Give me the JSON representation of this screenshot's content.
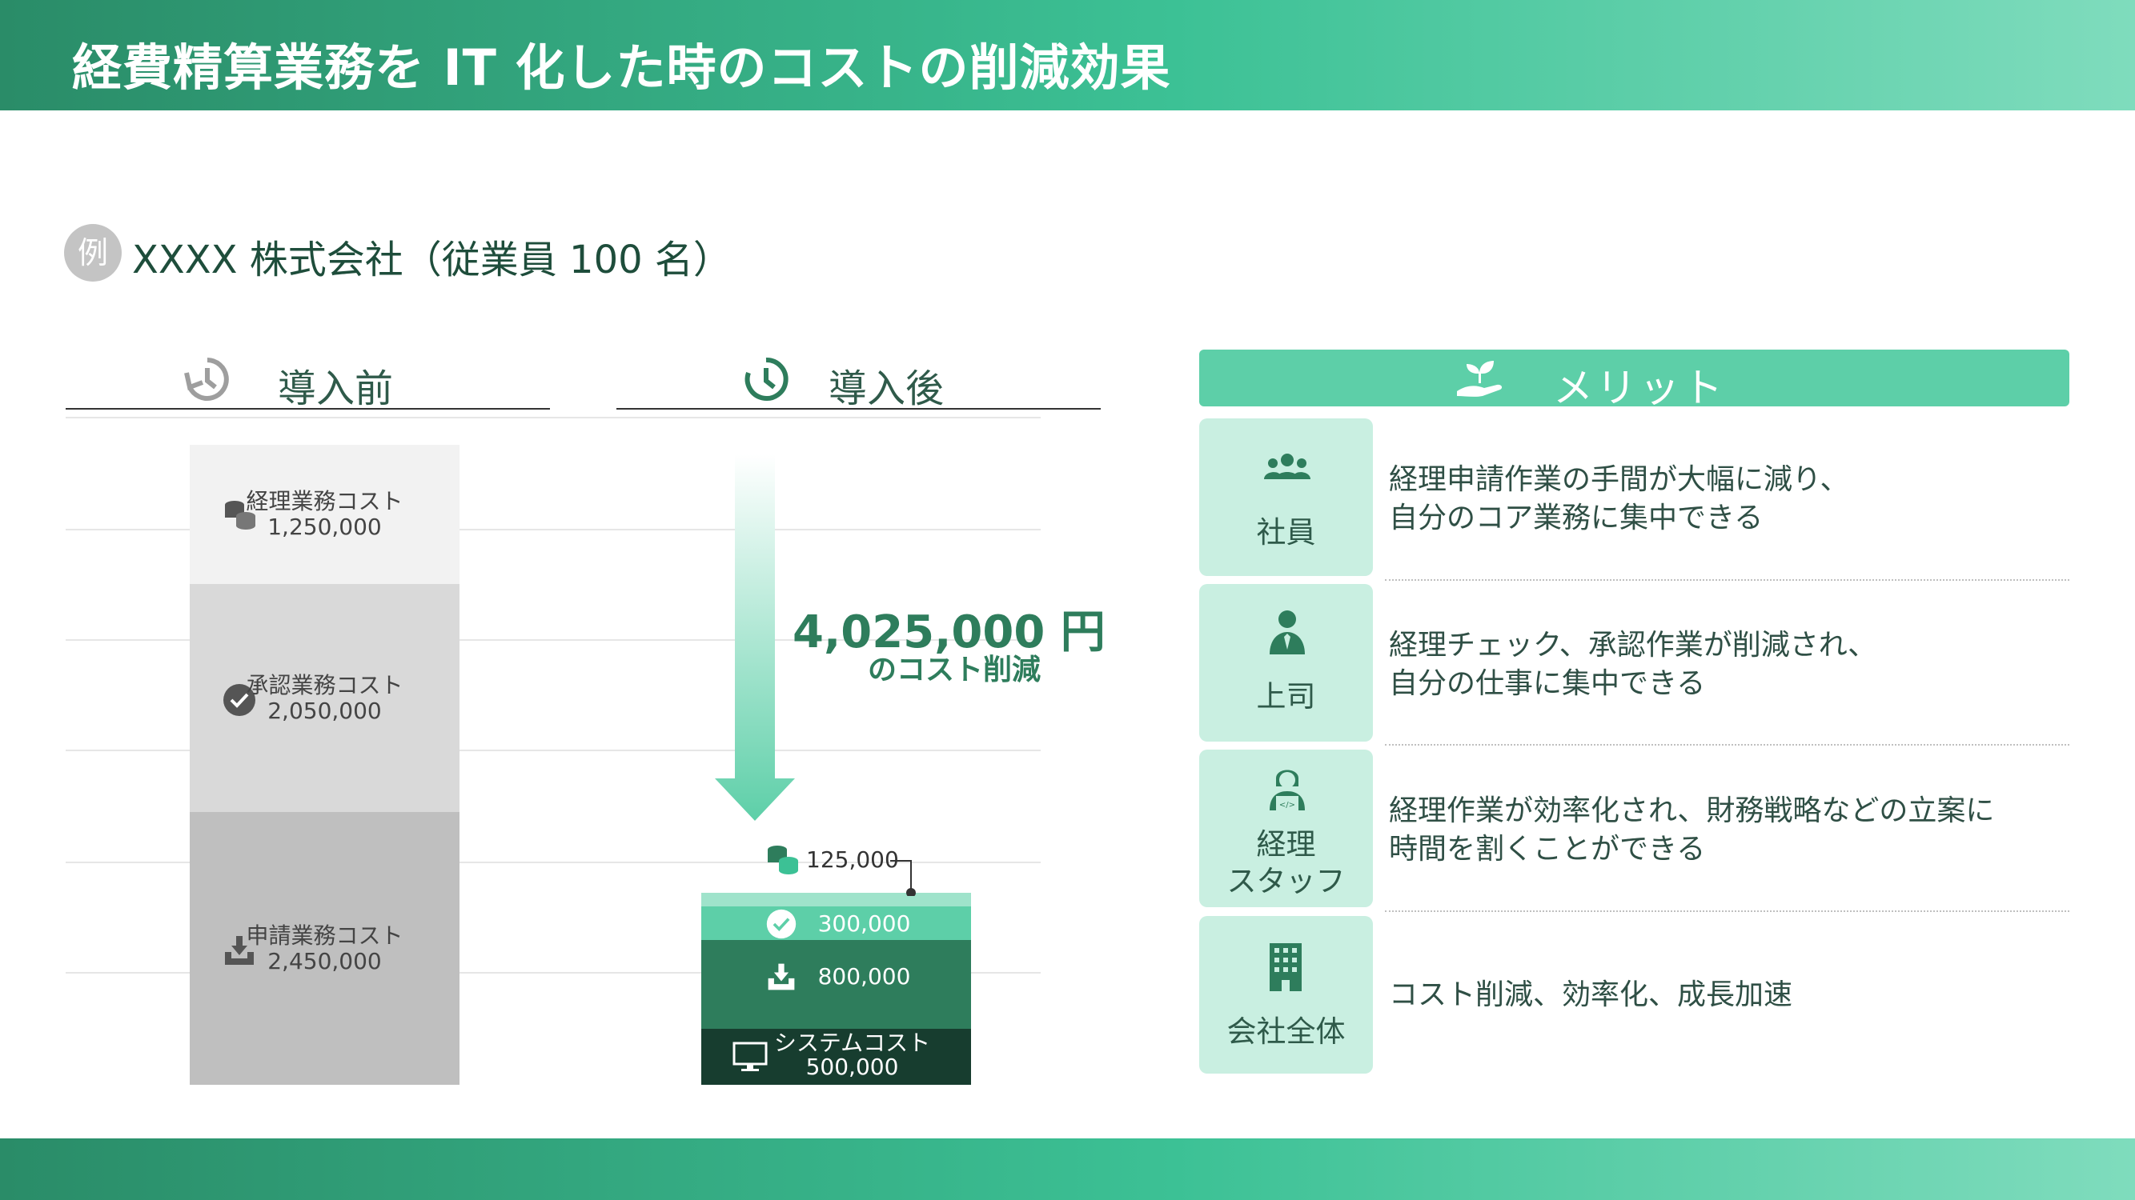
{
  "title": "経費精算業務を IT 化した時のコストの削減効果",
  "example_badge": "例",
  "company": "XXXX 株式会社（従業員 100 名）",
  "before_label": "導入前",
  "after_label": "導入後",
  "reduction": {
    "amount": "4,025,000 円",
    "caption": "のコスト削減"
  },
  "chart_data": {
    "type": "bar",
    "stacked": true,
    "categories": [
      "導入前",
      "導入後"
    ],
    "before_segments": [
      {
        "name": "経理業務コスト",
        "value": 1250000,
        "label": "1,250,000",
        "color": "#f2f2f2",
        "icon": "coins-icon"
      },
      {
        "name": "承認業務コスト",
        "value": 2050000,
        "label": "2,050,000",
        "color": "#d9d9d9",
        "icon": "check-circle-icon"
      },
      {
        "name": "申請業務コスト",
        "value": 2450000,
        "label": "2,450,000",
        "color": "#bfbfbf",
        "icon": "download-tray-icon"
      }
    ],
    "after_segments": [
      {
        "value": 125000,
        "label": "125,000",
        "color": "#9fe3cb",
        "icon": "coins-icon"
      },
      {
        "value": 300000,
        "label": "300,000",
        "color": "#5dcfa8",
        "icon": "check-circle-icon"
      },
      {
        "value": 800000,
        "label": "800,000",
        "color": "#2e7d5c",
        "icon": "download-tray-icon"
      },
      {
        "name": "システムコスト",
        "value": 500000,
        "label": "500,000",
        "color": "#173d2f",
        "icon": "monitor-icon"
      }
    ],
    "gridlines": true
  },
  "merits": {
    "header": "メリット",
    "items": [
      {
        "who": "社員",
        "text1": "経理申請作業の手間が大幅に減り、",
        "text2": "自分のコア業務に集中できる",
        "icon": "group-icon"
      },
      {
        "who": "上司",
        "text1": "経理チェック、承認作業が削減され、",
        "text2": "自分の仕事に集中できる",
        "icon": "manager-icon"
      },
      {
        "who": "経理",
        "who2": "スタッフ",
        "text1": "経理作業が効率化され、財務戦略などの立案に",
        "text2": "時間を割くことができる",
        "icon": "staff-laptop-icon"
      },
      {
        "who": "会社全体",
        "text1": "コスト削減、効率化、成長加速",
        "icon": "building-icon"
      }
    ]
  },
  "colors": {
    "accent": "#3cc195",
    "dark_green": "#2e7d5c",
    "mint": "#c9efe1",
    "merit_header": "#5dcfa8"
  }
}
